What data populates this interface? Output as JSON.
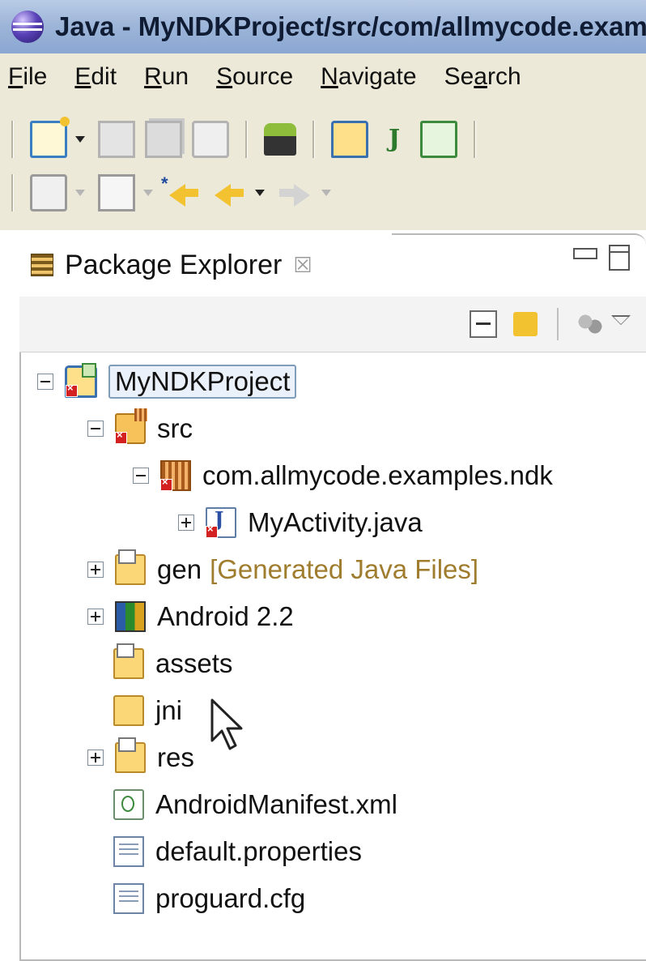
{
  "window": {
    "title": "Java - MyNDKProject/src/com/allmycode.examples.ndk/MyActivity.java"
  },
  "menu": [
    {
      "label": "File",
      "mnemonic": "F"
    },
    {
      "label": "Edit",
      "mnemonic": "E"
    },
    {
      "label": "Run",
      "mnemonic": "R"
    },
    {
      "label": "Source",
      "mnemonic": "S"
    },
    {
      "label": "Navigate",
      "mnemonic": "N"
    },
    {
      "label": "Search",
      "mnemonic": "a"
    }
  ],
  "toolbar": {
    "row1": [
      "new-wizard-icon",
      "save-icon",
      "save-all-icon",
      "print-icon",
      "android-sdk-manager-icon",
      "new-android-project-icon",
      "new-junit-test-icon",
      "new-class-icon"
    ],
    "row2": [
      "next-annotation-icon",
      "previous-annotation-icon",
      "last-edit-location-icon",
      "back-icon",
      "forward-icon"
    ]
  },
  "view": {
    "title": "Package Explorer",
    "close": "☒"
  },
  "tree": [
    {
      "label": "MyNDKProject",
      "depth": 0,
      "expander": "minus",
      "icon": "android-project-icon",
      "selected": true,
      "error": true
    },
    {
      "label": "src",
      "depth": 1,
      "expander": "minus",
      "icon": "source-folder-icon",
      "error": true
    },
    {
      "label": "com.allmycode.examples.ndk",
      "depth": 2,
      "expander": "minus",
      "icon": "package-icon",
      "error": true
    },
    {
      "label": "MyActivity.java",
      "depth": 3,
      "expander": "plus",
      "icon": "java-file-icon",
      "error": true
    },
    {
      "label": "gen",
      "decoration": "[Generated Java Files]",
      "depth": 1,
      "expander": "plus",
      "icon": "gen-folder-icon"
    },
    {
      "label": "Android 2.2",
      "depth": 1,
      "expander": "plus",
      "icon": "library-icon"
    },
    {
      "label": "assets",
      "depth": 1,
      "expander": "none",
      "icon": "folder-icon"
    },
    {
      "label": "jni",
      "depth": 1,
      "expander": "none",
      "icon": "folder-icon"
    },
    {
      "label": "res",
      "depth": 1,
      "expander": "plus",
      "icon": "res-folder-icon"
    },
    {
      "label": "AndroidManifest.xml",
      "depth": 1,
      "expander": "none",
      "icon": "xml-file-icon"
    },
    {
      "label": "default.properties",
      "depth": 1,
      "expander": "none",
      "icon": "text-file-icon"
    },
    {
      "label": "proguard.cfg",
      "depth": 1,
      "expander": "none",
      "icon": "text-file-icon"
    }
  ]
}
